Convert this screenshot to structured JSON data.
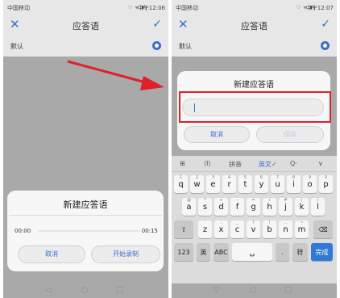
{
  "left_screen": {
    "status": {
      "carrier": "中国移动",
      "icons": "♡ ᯤ ▮▯",
      "time": "中午12:06"
    },
    "title": "应答语",
    "close_glyph": "✕",
    "confirm_glyph": "✓",
    "default_label": "默认",
    "dialog": {
      "title": "新建应答语",
      "time_start": "00:00",
      "time_end": "00:15",
      "cancel_label": "取消",
      "record_label": "开始录制"
    },
    "nav": {
      "back": "◁",
      "home": "○",
      "recent": "□"
    }
  },
  "right_screen": {
    "status": {
      "carrier": "中国移动",
      "icons": "♡ ᯤ ▮▯",
      "time": "中午12:07"
    },
    "title": "应答语",
    "close_glyph": "✕",
    "confirm_glyph": "✓",
    "default_label": "默认",
    "dialog": {
      "title": "新建应答语",
      "input_value": "",
      "cancel_label": "取消",
      "save_label": "保存"
    },
    "keyboard": {
      "candidates": {
        "grid": "⊞",
        "cursor": "⟨I⟩",
        "pinyin": "拼音",
        "english": "英文✓",
        "search": "Q·",
        "collapse": "∨"
      },
      "row1": [
        {
          "k": "q",
          "s": "1"
        },
        {
          "k": "w",
          "s": "2"
        },
        {
          "k": "e",
          "s": "3"
        },
        {
          "k": "r",
          "s": "4"
        },
        {
          "k": "t",
          "s": "5"
        },
        {
          "k": "y",
          "s": "6"
        },
        {
          "k": "u",
          "s": "7"
        },
        {
          "k": "i",
          "s": "8"
        },
        {
          "k": "o",
          "s": "9"
        },
        {
          "k": "p",
          "s": "0"
        }
      ],
      "row2": [
        {
          "k": "a",
          "s": "@"
        },
        {
          "k": "s",
          "s": "*"
        },
        {
          "k": "d",
          "s": "+"
        },
        {
          "k": "f",
          "s": "-"
        },
        {
          "k": "g",
          "s": "="
        },
        {
          "k": "h",
          "s": "/"
        },
        {
          "k": "j",
          "s": "#"
        },
        {
          "k": "k",
          "s": "("
        },
        {
          "k": "l",
          "s": ")"
        }
      ],
      "row3": [
        {
          "k": "z",
          "s": "'"
        },
        {
          "k": "x",
          "s": ":"
        },
        {
          "k": "c",
          "s": "_"
        },
        {
          "k": "v",
          "s": "?"
        },
        {
          "k": "b",
          "s": "!"
        },
        {
          "k": "n",
          "s": "..."
        },
        {
          "k": "m",
          "s": "~"
        }
      ],
      "shift": "⇧",
      "backspace": "⌫",
      "num_key": "123",
      "lang_key": "英",
      "abc_key": "ABC",
      "space": "␣",
      "dot_key": ".",
      "symbol_key": "符",
      "done_key": "完成"
    },
    "nav": {
      "back": "▽",
      "home": "○",
      "recent": "□"
    }
  },
  "colors": {
    "accent": "#3a6fc9",
    "annotation_red": "#e0202a",
    "done": "#2f7ad6"
  }
}
